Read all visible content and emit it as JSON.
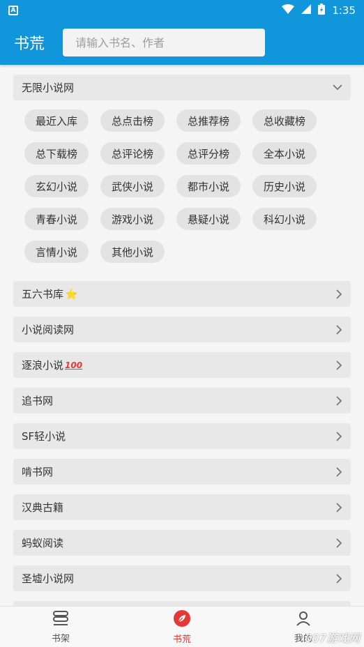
{
  "status_bar": {
    "app_badge": "A",
    "time": "1:35"
  },
  "app_bar": {
    "title": "书荒",
    "search_placeholder": "请输入书名、作者"
  },
  "expanded_source": {
    "name": "无限小说网",
    "categories": [
      "最近入库",
      "总点击榜",
      "总推荐榜",
      "总收藏榜",
      "总下载榜",
      "总评论榜",
      "总评分榜",
      "全本小说",
      "玄幻小说",
      "武侠小说",
      "都市小说",
      "历史小说",
      "青春小说",
      "游戏小说",
      "悬疑小说",
      "科幻小说",
      "言情小说",
      "其他小说"
    ]
  },
  "sources": [
    {
      "name": "五六书库",
      "emoji": "⭐"
    },
    {
      "name": "小说阅读网"
    },
    {
      "name": "逐浪小说",
      "emoji": "100"
    },
    {
      "name": "追书网"
    },
    {
      "name": "SF轻小说"
    },
    {
      "name": "啃书网"
    },
    {
      "name": "汉典古籍"
    },
    {
      "name": "蚂蚁阅读"
    },
    {
      "name": "圣墟小说网"
    }
  ],
  "bottom_nav": [
    {
      "label": "书架",
      "icon": "bookshelf-icon",
      "active": false
    },
    {
      "label": "书荒",
      "icon": "leaf-icon",
      "active": true
    },
    {
      "label": "我的",
      "icon": "person-icon",
      "active": false
    }
  ],
  "watermark": "007游戏网",
  "colors": {
    "primary": "#1296db",
    "active_nav": "#e53935",
    "row_bg": "#e8e8e8"
  }
}
